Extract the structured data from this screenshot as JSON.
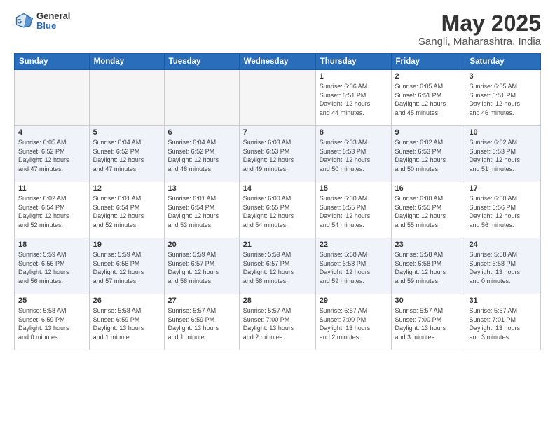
{
  "header": {
    "logo_general": "General",
    "logo_blue": "Blue",
    "title": "May 2025",
    "location": "Sangli, Maharashtra, India"
  },
  "days_of_week": [
    "Sunday",
    "Monday",
    "Tuesday",
    "Wednesday",
    "Thursday",
    "Friday",
    "Saturday"
  ],
  "weeks": [
    [
      {
        "num": "",
        "info": ""
      },
      {
        "num": "",
        "info": ""
      },
      {
        "num": "",
        "info": ""
      },
      {
        "num": "",
        "info": ""
      },
      {
        "num": "1",
        "info": "Sunrise: 6:06 AM\nSunset: 6:51 PM\nDaylight: 12 hours\nand 44 minutes."
      },
      {
        "num": "2",
        "info": "Sunrise: 6:05 AM\nSunset: 6:51 PM\nDaylight: 12 hours\nand 45 minutes."
      },
      {
        "num": "3",
        "info": "Sunrise: 6:05 AM\nSunset: 6:51 PM\nDaylight: 12 hours\nand 46 minutes."
      }
    ],
    [
      {
        "num": "4",
        "info": "Sunrise: 6:05 AM\nSunset: 6:52 PM\nDaylight: 12 hours\nand 47 minutes."
      },
      {
        "num": "5",
        "info": "Sunrise: 6:04 AM\nSunset: 6:52 PM\nDaylight: 12 hours\nand 47 minutes."
      },
      {
        "num": "6",
        "info": "Sunrise: 6:04 AM\nSunset: 6:52 PM\nDaylight: 12 hours\nand 48 minutes."
      },
      {
        "num": "7",
        "info": "Sunrise: 6:03 AM\nSunset: 6:53 PM\nDaylight: 12 hours\nand 49 minutes."
      },
      {
        "num": "8",
        "info": "Sunrise: 6:03 AM\nSunset: 6:53 PM\nDaylight: 12 hours\nand 50 minutes."
      },
      {
        "num": "9",
        "info": "Sunrise: 6:02 AM\nSunset: 6:53 PM\nDaylight: 12 hours\nand 50 minutes."
      },
      {
        "num": "10",
        "info": "Sunrise: 6:02 AM\nSunset: 6:53 PM\nDaylight: 12 hours\nand 51 minutes."
      }
    ],
    [
      {
        "num": "11",
        "info": "Sunrise: 6:02 AM\nSunset: 6:54 PM\nDaylight: 12 hours\nand 52 minutes."
      },
      {
        "num": "12",
        "info": "Sunrise: 6:01 AM\nSunset: 6:54 PM\nDaylight: 12 hours\nand 52 minutes."
      },
      {
        "num": "13",
        "info": "Sunrise: 6:01 AM\nSunset: 6:54 PM\nDaylight: 12 hours\nand 53 minutes."
      },
      {
        "num": "14",
        "info": "Sunrise: 6:00 AM\nSunset: 6:55 PM\nDaylight: 12 hours\nand 54 minutes."
      },
      {
        "num": "15",
        "info": "Sunrise: 6:00 AM\nSunset: 6:55 PM\nDaylight: 12 hours\nand 54 minutes."
      },
      {
        "num": "16",
        "info": "Sunrise: 6:00 AM\nSunset: 6:55 PM\nDaylight: 12 hours\nand 55 minutes."
      },
      {
        "num": "17",
        "info": "Sunrise: 6:00 AM\nSunset: 6:56 PM\nDaylight: 12 hours\nand 56 minutes."
      }
    ],
    [
      {
        "num": "18",
        "info": "Sunrise: 5:59 AM\nSunset: 6:56 PM\nDaylight: 12 hours\nand 56 minutes."
      },
      {
        "num": "19",
        "info": "Sunrise: 5:59 AM\nSunset: 6:56 PM\nDaylight: 12 hours\nand 57 minutes."
      },
      {
        "num": "20",
        "info": "Sunrise: 5:59 AM\nSunset: 6:57 PM\nDaylight: 12 hours\nand 58 minutes."
      },
      {
        "num": "21",
        "info": "Sunrise: 5:59 AM\nSunset: 6:57 PM\nDaylight: 12 hours\nand 58 minutes."
      },
      {
        "num": "22",
        "info": "Sunrise: 5:58 AM\nSunset: 6:58 PM\nDaylight: 12 hours\nand 59 minutes."
      },
      {
        "num": "23",
        "info": "Sunrise: 5:58 AM\nSunset: 6:58 PM\nDaylight: 12 hours\nand 59 minutes."
      },
      {
        "num": "24",
        "info": "Sunrise: 5:58 AM\nSunset: 6:58 PM\nDaylight: 13 hours\nand 0 minutes."
      }
    ],
    [
      {
        "num": "25",
        "info": "Sunrise: 5:58 AM\nSunset: 6:59 PM\nDaylight: 13 hours\nand 0 minutes."
      },
      {
        "num": "26",
        "info": "Sunrise: 5:58 AM\nSunset: 6:59 PM\nDaylight: 13 hours\nand 1 minute."
      },
      {
        "num": "27",
        "info": "Sunrise: 5:57 AM\nSunset: 6:59 PM\nDaylight: 13 hours\nand 1 minute."
      },
      {
        "num": "28",
        "info": "Sunrise: 5:57 AM\nSunset: 7:00 PM\nDaylight: 13 hours\nand 2 minutes."
      },
      {
        "num": "29",
        "info": "Sunrise: 5:57 AM\nSunset: 7:00 PM\nDaylight: 13 hours\nand 2 minutes."
      },
      {
        "num": "30",
        "info": "Sunrise: 5:57 AM\nSunset: 7:00 PM\nDaylight: 13 hours\nand 3 minutes."
      },
      {
        "num": "31",
        "info": "Sunrise: 5:57 AM\nSunset: 7:01 PM\nDaylight: 13 hours\nand 3 minutes."
      }
    ]
  ]
}
